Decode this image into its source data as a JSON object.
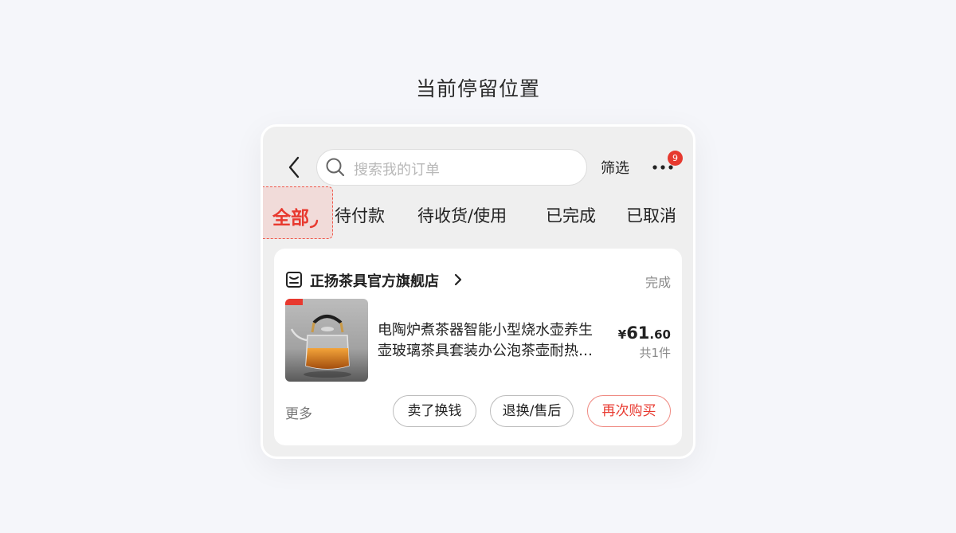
{
  "caption": "当前停留位置",
  "header": {
    "search_placeholder": "搜索我的订单",
    "filter_label": "筛选",
    "notification_count": "9"
  },
  "tabs": [
    {
      "label": "全部",
      "active": true
    },
    {
      "label": "待付款",
      "active": false
    },
    {
      "label": "待收货/使用",
      "active": false
    },
    {
      "label": "已完成",
      "active": false
    },
    {
      "label": "已取消",
      "active": false
    }
  ],
  "order": {
    "shop_name": "正扬茶具官方旗舰店",
    "status": "完成",
    "product": {
      "title_line1": "电陶炉煮茶器智能小型烧水壶养生",
      "title_line2": "壶玻璃茶具套装办公泡茶壶耐热…",
      "price_symbol": "¥",
      "price_int": "61",
      "price_dec": ".60",
      "quantity": "共1件"
    },
    "more_label": "更多",
    "actions": {
      "sell": "卖了换钱",
      "refund": "退换/售后",
      "rebuy": "再次购买"
    }
  },
  "colors": {
    "accent": "#e8392f",
    "background": "#f5f6fa",
    "panel": "#efefef"
  }
}
